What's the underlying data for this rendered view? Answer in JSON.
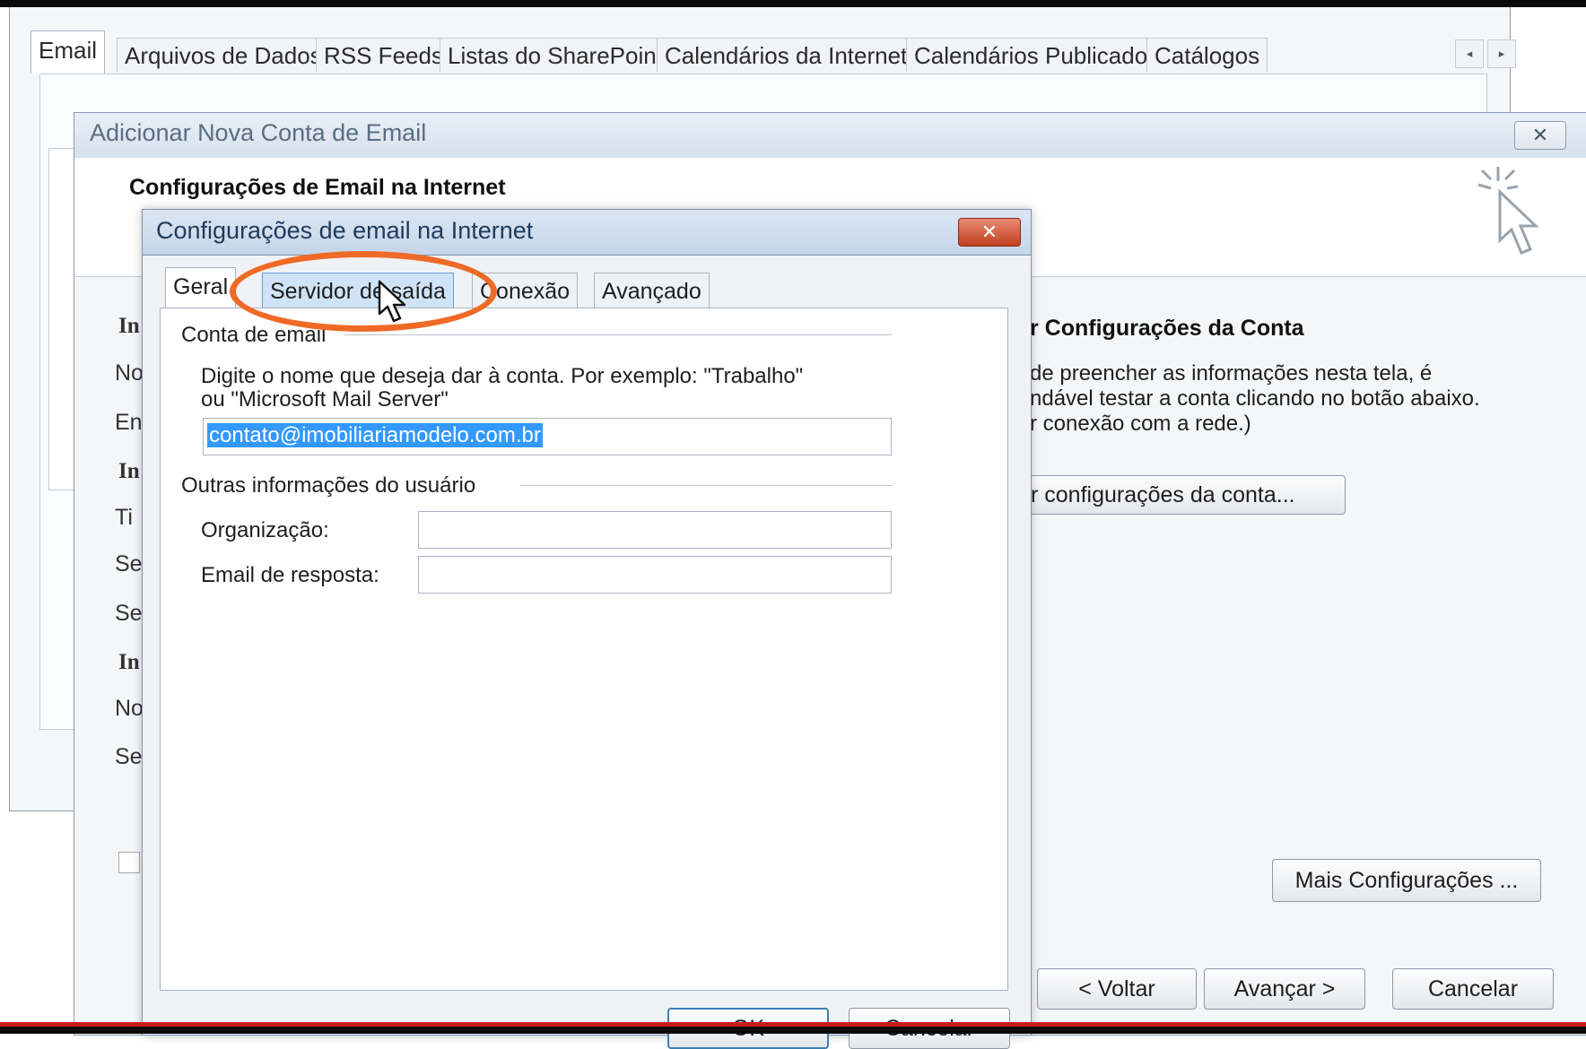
{
  "account_settings": {
    "tabs": [
      {
        "label": "Email",
        "active": true
      },
      {
        "label": "Arquivos de Dados"
      },
      {
        "label": "RSS Feeds"
      },
      {
        "label": "Listas do SharePoint"
      },
      {
        "label": "Calendários da Internet"
      },
      {
        "label": "Calendários Publicados"
      },
      {
        "label": "Catálogos"
      }
    ],
    "scroll_left": "◂",
    "scroll_right": "▸"
  },
  "wizard": {
    "title": "Adicionar Nova Conta de Email",
    "close": "✕",
    "heading": "Configurações de Email na Internet",
    "partial_labels": [
      "In",
      "No",
      "En",
      "In",
      "Ti",
      "Se",
      "Se",
      "In",
      "No",
      "Se"
    ],
    "test_group_title": "r Configurações da Conta",
    "test_description": [
      "de preencher as informações nesta tela, é",
      "ndável testar a conta clicando no botão abaixo.",
      "r conexão com a rede.)"
    ],
    "test_button": "r configurações da conta...",
    "more_settings_button": "Mais Configurações ...",
    "back_button": "< Voltar",
    "next_button": "Avançar >",
    "cancel_button": "Cancelar"
  },
  "dialog": {
    "title": "Configurações de email na Internet",
    "close": "✕",
    "tabs": [
      {
        "label": "Geral",
        "active": true
      },
      {
        "label": "Servidor de saída",
        "highlighted": true
      },
      {
        "label": "Conexão"
      },
      {
        "label": "Avançado"
      }
    ],
    "account_section": "Conta de email",
    "account_description_line1": "Digite o nome que deseja dar à conta. Por exemplo: \"Trabalho\"",
    "account_description_line2": "ou \"Microsoft Mail Server\"",
    "account_name_value": "contato@imobiliariamodelo.com.br",
    "other_info_section": "Outras informações do usuário",
    "organization_label": "Organização:",
    "organization_value": "",
    "reply_email_label": "Email de resposta:",
    "reply_email_value": "",
    "ok_button": "OK",
    "cancel_button": "Cancelar"
  },
  "annotation_color": "#ef6a25"
}
